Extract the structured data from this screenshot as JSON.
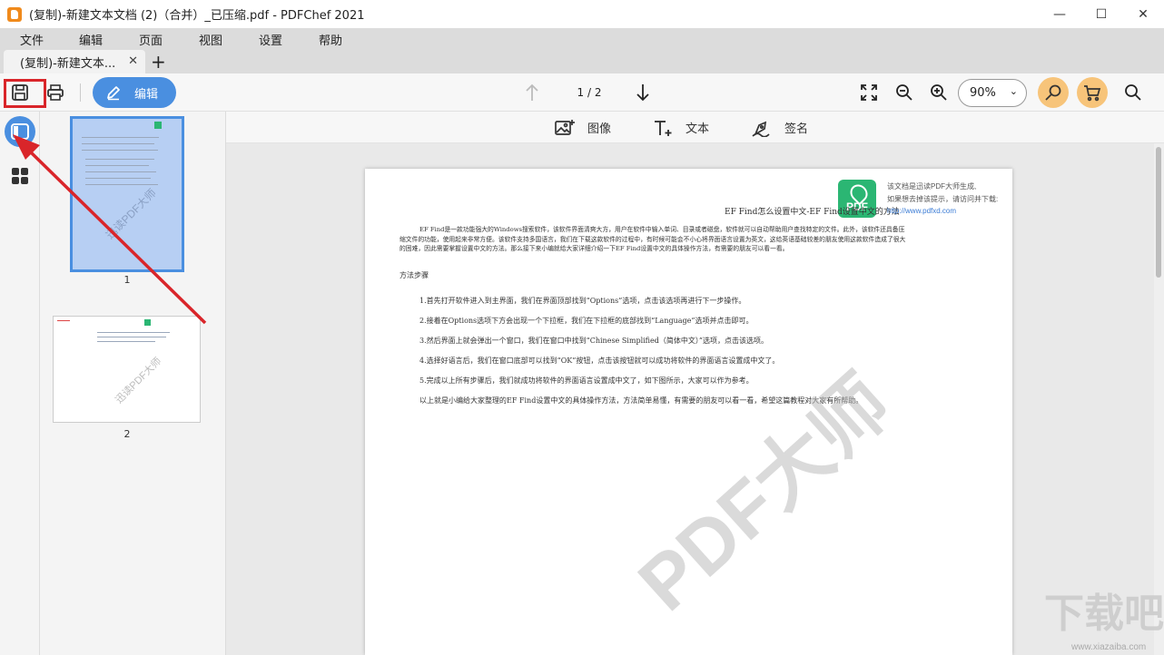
{
  "window": {
    "title": "(复制)-新建文本文档 (2)（合并）_已压缩.pdf - PDFChef 2021",
    "controls": {
      "minimize": "—",
      "maximize": "☐",
      "close": "✕"
    }
  },
  "menu": [
    "文件",
    "编辑",
    "页面",
    "视图",
    "设置",
    "帮助"
  ],
  "tabs": [
    {
      "label": "(复制)-新建文本...",
      "close": "✕"
    }
  ],
  "new_tab": "+",
  "toolbar": {
    "edit_label": "编辑",
    "page_indicator": "1 / 2",
    "zoom": "90%",
    "zoom_chevron": "⌄"
  },
  "tools": {
    "image_label": "图像",
    "text_label": "文本",
    "sign_label": "签名"
  },
  "thumbnails": [
    {
      "page": "1",
      "watermark": "迅读PDF大师"
    },
    {
      "page": "2",
      "watermark": "迅读PDF大师"
    }
  ],
  "document": {
    "logo_text": "PDF",
    "header_note_1": "该文档是迅读PDF大师生成,",
    "header_note_2": "如果想去掉该提示，请访问并下载:",
    "header_link": "http://www.pdfxd.com",
    "title": "EF Find怎么设置中文-EF Find设置中文的方法",
    "intro": "EF Find是一款功能强大的Windows搜索软件，该软件界面清爽大方，用户在软件中输入单词、目录或者磁盘，软件就可以自动帮助用户查找特定的文件。此外，该软件还具备压缩文件的功能，使用起来非常方便。该软件支持多国语言，我们在下载这款软件的过程中，有时候可能会不小心将界面语言设置为英文，这给英语基础较差的朋友使用这款软件造成了很大的困难，因此需要掌握设置中文的方法。那么接下来小编就给大家详细介绍一下EF Find设置中文的具体操作方法，有需要的朋友可以看一看。",
    "section": "方法步骤",
    "steps": [
      "1.首先打开软件进入到主界面，我们在界面顶部找到“Options”选项，点击该选项再进行下一步操作。",
      "2.接着在Options选项下方会出现一个下拉框，我们在下拉框的底部找到“Language”选项并点击即可。",
      "3.然后界面上就会弹出一个窗口，我们在窗口中找到“Chinese Simplified（简体中文）”选项，点击该选项。",
      "4.选择好语言后，我们在窗口底部可以找到“OK”按钮，点击该按钮就可以成功将软件的界面语言设置成中文了。",
      "5.完成以上所有步骤后，我们就成功将软件的界面语言设置成中文了，如下图所示，大家可以作为参考。",
      "以上就是小编给大家整理的EF Find设置中文的具体操作方法，方法简单易懂，有需要的朋友可以看一看，希望这篇教程对大家有所帮助。"
    ],
    "watermark": "PDF大师"
  },
  "site": {
    "mark": "下载吧",
    "url": "www.xiazaiba.com"
  },
  "colors": {
    "accent": "#4a8fe0",
    "highlight": "#d9252a",
    "orange": "#f7c47a",
    "logo_green": "#2bb673"
  }
}
